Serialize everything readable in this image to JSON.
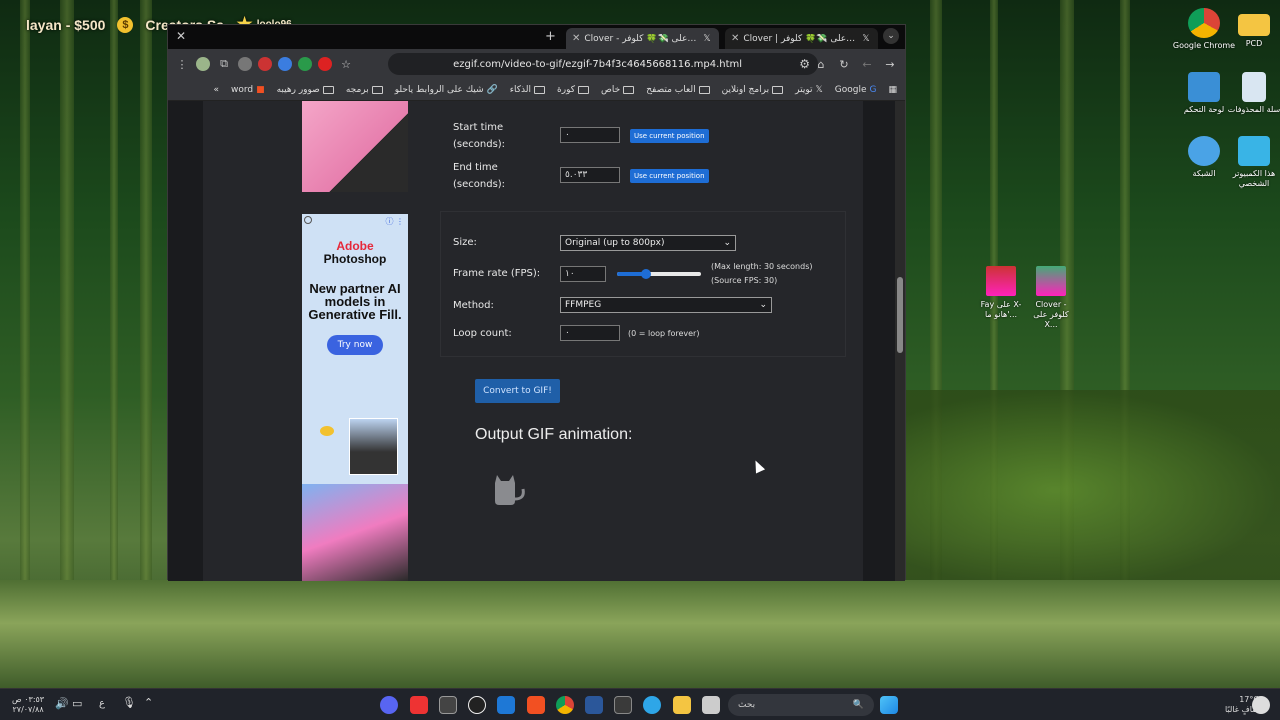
{
  "overlay": {
    "item1": "layan - $500",
    "coin_symbol": "$",
    "item2": "Creators Sa -",
    "item3": "loolo96"
  },
  "browser": {
    "tabs": [
      {
        "title": "Clover - على 💸🍀 كلوفر X- '@",
        "icon": "x-icon",
        "active": true
      },
      {
        "title": "Clover | على 💸🍀 كلوفر X: \"الـ",
        "icon": "x-icon",
        "active": false
      }
    ],
    "url": "ezgif.com/video-to-gif/ezgif-7b4f3c4645668116.mp4.html",
    "bookmarks": [
      {
        "label": "Google",
        "icon": "google-icon"
      },
      {
        "label": "تويتر",
        "icon": "x-icon"
      },
      {
        "label": "برامج اونلاين",
        "icon": "folder-icon"
      },
      {
        "label": "العاب متصفح",
        "icon": "folder-icon"
      },
      {
        "label": "خاص",
        "icon": "folder-icon"
      },
      {
        "label": "كورة",
        "icon": "folder-icon"
      },
      {
        "label": "الذكاء",
        "icon": "folder-icon"
      },
      {
        "label": "شيك على الروابط ياحلو",
        "icon": "link-icon"
      },
      {
        "label": "برمجه",
        "icon": "folder-icon"
      },
      {
        "label": "صوور رهيبه",
        "icon": "folder-icon"
      },
      {
        "label": "word",
        "icon": "microsoft-icon"
      }
    ],
    "more_bookmarks": "»"
  },
  "ezgif": {
    "start_time_label": "Start time\n(seconds):",
    "start_time_value": "٠",
    "end_time_label": "End time\n(seconds):",
    "end_time_value": "٥.٠٣٣",
    "use_current": "Use current position",
    "size_label": "Size:",
    "size_value": "Original (up to 800px)",
    "framerate_label": "Frame rate (FPS):",
    "framerate_value": "١٠",
    "framerate_hint_1": "(Max length: 30 seconds)",
    "framerate_hint_2": "(Source FPS: 30)",
    "framerate_slider_fraction": 0.35,
    "method_label": "Method:",
    "method_value": "FFMPEG",
    "loop_label": "Loop count:",
    "loop_value": "٠",
    "loop_hint": "(0 = loop forever)",
    "convert_button": "Convert to GIF!",
    "output_title": "Output GIF animation:"
  },
  "ad": {
    "brand_line1": "Adobe",
    "brand_line2": "Photoshop",
    "headline": "New partner AI models in Generative Fill.",
    "cta": "Try now"
  },
  "desktop": {
    "icons": [
      {
        "label": "Google Chrome",
        "icon": "chrome-icon"
      },
      {
        "label": "PCD",
        "icon": "folder-icon"
      },
      {
        "label": "لوحة التحكم",
        "icon": "control-panel-icon"
      },
      {
        "label": "سلة المحذوفات",
        "icon": "recycle-bin-icon"
      },
      {
        "label": "الشبكة",
        "icon": "network-icon"
      },
      {
        "label": "هذا الكمبيوتر الشخصي",
        "icon": "computer-icon"
      }
    ],
    "thumbs": [
      {
        "label": "Fay على X- هانو ما'..."
      },
      {
        "label": "Clover - كلوفر على X..."
      }
    ]
  },
  "taskbar": {
    "search_placeholder": "بحث",
    "weather_temp": "17°C",
    "weather_text": "صافٍ غالبًا",
    "time": "٠٣:٥٣ ص",
    "date": "٢٧/٠٧/٨٨",
    "lang": "ع"
  }
}
